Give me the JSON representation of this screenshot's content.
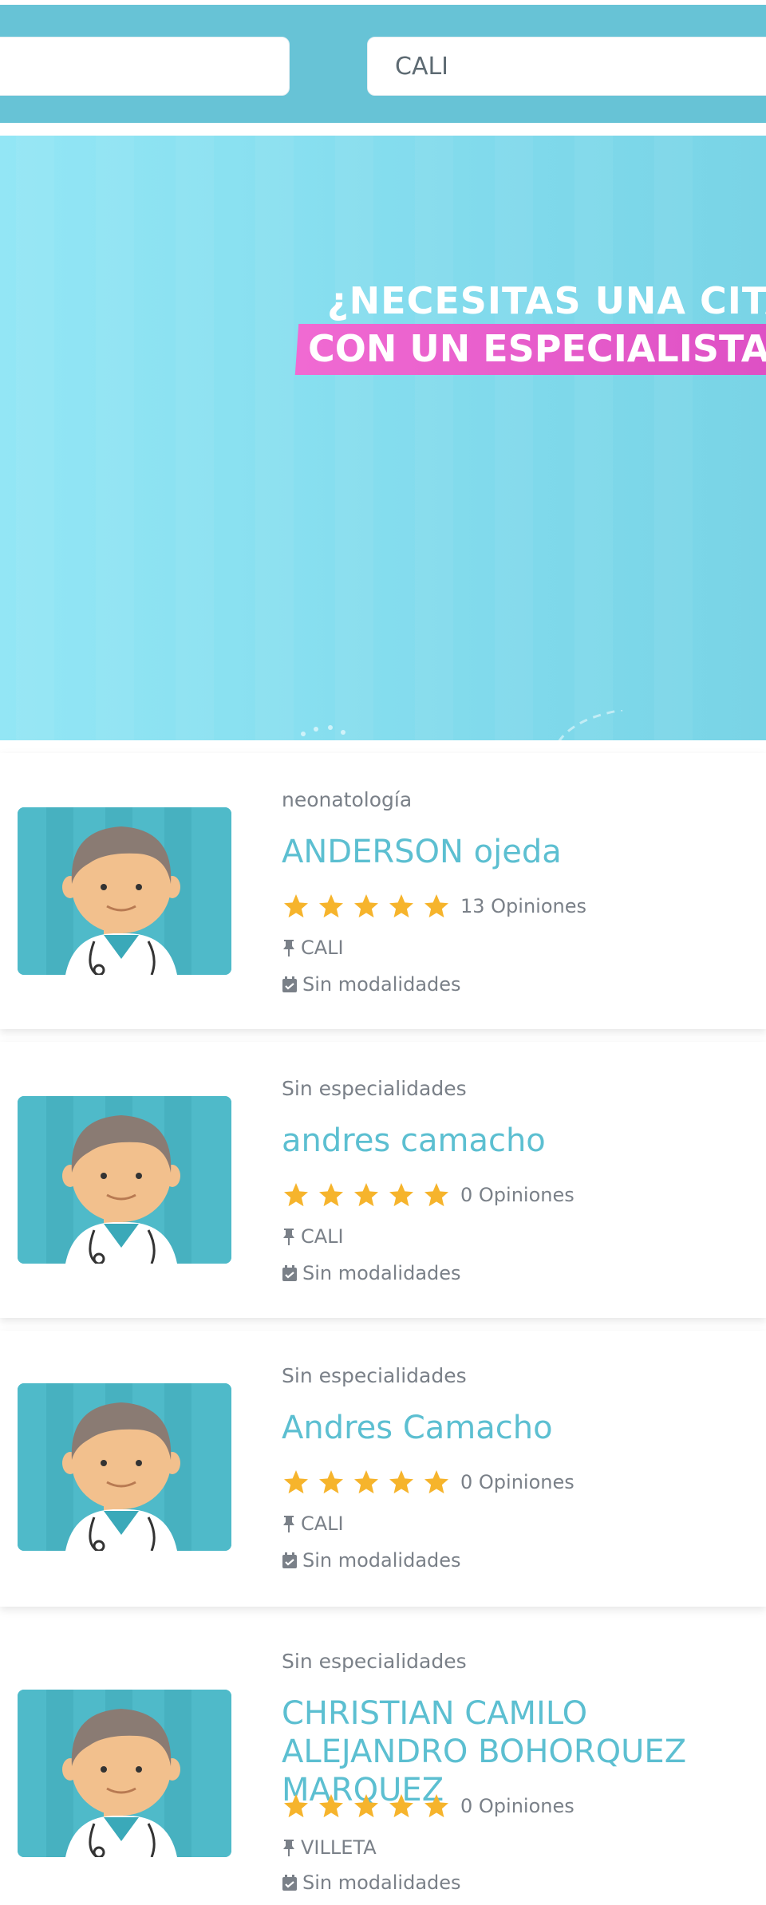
{
  "search": {
    "left_value": "",
    "city_value": "CALI"
  },
  "banner": {
    "line1": "¿NECESITAS UNA CITA",
    "line2": "CON UN ESPECIALISTA?"
  },
  "doctors": [
    {
      "specialty": "neonatología",
      "name": "ANDERSON ojeda",
      "rating": 5,
      "reviews": "13 Opiniones",
      "city": "CALI",
      "modality": "Sin modalidades"
    },
    {
      "specialty": "Sin especialidades",
      "name": "andres camacho",
      "rating": 5,
      "reviews": "0 Opiniones",
      "city": "CALI",
      "modality": "Sin modalidades"
    },
    {
      "specialty": "Sin especialidades",
      "name": "Andres Camacho",
      "rating": 5,
      "reviews": "0 Opiniones",
      "city": "CALI",
      "modality": "Sin modalidades"
    },
    {
      "specialty": "Sin especialidades",
      "name": "CHRISTIAN CAMILO ALEJANDRO BOHORQUEZ MARQUEZ",
      "rating": 5,
      "reviews": "0 Opiniones",
      "city": "VILLETA",
      "modality": "Sin modalidades"
    }
  ],
  "colors": {
    "header_bg": "#67c3d6",
    "name_link": "#5cbfd1",
    "star": "#f6b42c",
    "highlight": "#e05ac8"
  },
  "icons": {
    "star": "star-icon",
    "location": "pin-icon",
    "modality": "calendar-check-icon"
  }
}
